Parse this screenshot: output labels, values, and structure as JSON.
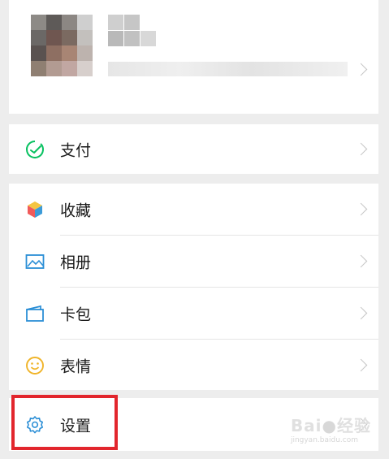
{
  "menu": {
    "pay": {
      "label": "支付",
      "icon": "pay-icon"
    },
    "favorites": {
      "label": "收藏",
      "icon": "cube-icon"
    },
    "album": {
      "label": "相册",
      "icon": "image-icon"
    },
    "cards": {
      "label": "卡包",
      "icon": "wallet-icon"
    },
    "stickers": {
      "label": "表情",
      "icon": "smile-icon"
    },
    "settings": {
      "label": "设置",
      "icon": "gear-icon"
    }
  },
  "colors": {
    "background": "#ededed",
    "accent_green": "#07c160",
    "highlight_red": "#e2262d"
  }
}
